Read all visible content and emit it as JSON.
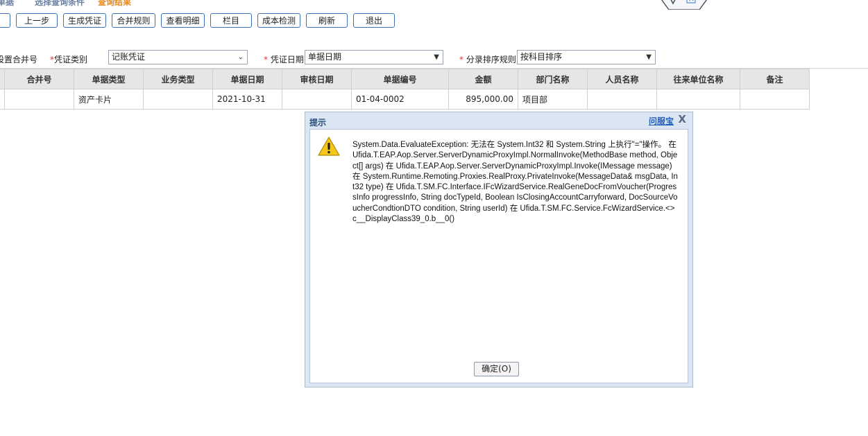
{
  "steps": [
    "单据",
    "选择查询条件",
    "查询结果"
  ],
  "toolbar": {
    "buttons": [
      "",
      "上一步",
      "生成凭证",
      "合并规则",
      "查看明细",
      "栏目",
      "成本检测",
      "刷新",
      "退出"
    ]
  },
  "form": {
    "merge_label": "设置合并号",
    "voucher_type_label": "凭证类别",
    "voucher_type_value": "记账凭证",
    "voucher_date_label": "凭证日期",
    "voucher_date_value": "单据日期",
    "sort_label": "分录排序规则",
    "sort_value": "按科目排序",
    "required_mark": "*"
  },
  "table": {
    "columns": [
      "",
      "合并号",
      "单据类型",
      "业务类型",
      "单据日期",
      "审核日期",
      "单据编号",
      "金额",
      "部门名称",
      "人员名称",
      "往来单位名称",
      "备注"
    ],
    "rows": [
      [
        "",
        "",
        "资产卡片",
        "",
        "2021-10-31",
        "",
        "01-04-0002",
        "895,000.00",
        "项目部",
        "",
        "",
        ""
      ]
    ]
  },
  "dialog": {
    "title": "提示",
    "help_link": "问服宝",
    "close": "X",
    "message": "System.Data.EvaluateException: 无法在 System.Int32 和 System.String 上执行\"=\"操作。 在 Ufida.T.EAP.Aop.Server.ServerDynamicProxyImpl.NormalInvoke(MethodBase method, Object[] args) 在 Ufida.T.EAP.Aop.Server.ServerDynamicProxyImpl.Invoke(IMessage message) 在 System.Runtime.Remoting.Proxies.RealProxy.PrivateInvoke(MessageData& msgData, Int32 type) 在 Ufida.T.SM.FC.Interface.IFcWizardService.RealGeneDocFromVoucher(ProgressInfo progressInfo, String docTypeId, Boolean IsClosingAccountCarryforward, DocSourceVoucherCondtionDTO condition, String userId) 在 Ufida.T.SM.FC.Service.FcWizardService.<>c__DisplayClass39_0.b__0()",
    "ok_label": "确定(O)",
    "icon": "warning-icon"
  }
}
